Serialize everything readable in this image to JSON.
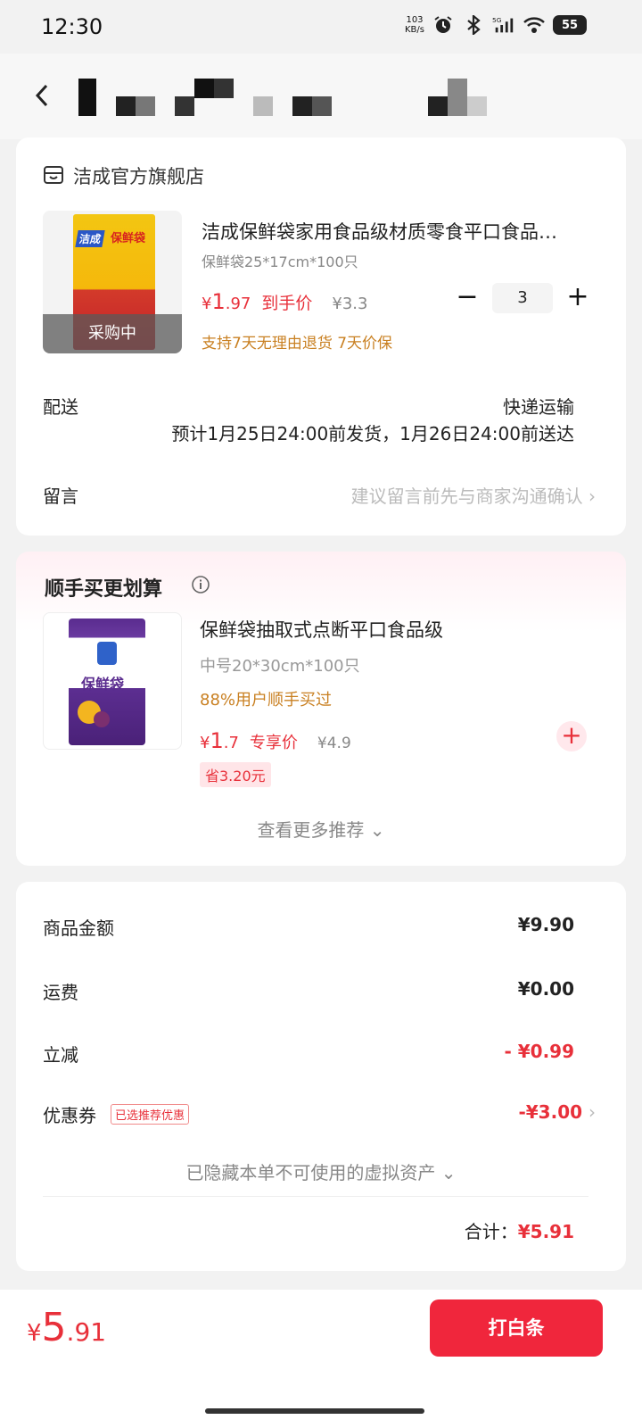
{
  "status_bar": {
    "time": "12:30",
    "speed_value": "103",
    "speed_unit": "KB/s",
    "battery": "55"
  },
  "header": {
    "title": ""
  },
  "order": {
    "store_name": "洁成官方旗舰店",
    "product": {
      "image_brand": "洁成",
      "image_name": "保鲜袋",
      "title": "洁成保鲜袋家用食品级材质零食平口食品…",
      "spec": "保鲜袋25*17cm*100只",
      "price_symbol": "¥",
      "price_int": "1",
      "price_dec": ".97",
      "price_tag": "到手价",
      "original_price": "¥3.3",
      "quantity": "3",
      "guarantee": "支持7天无理由退货 7天价保",
      "overlay": "采购中"
    },
    "delivery_label": "配送",
    "delivery_method": "快递运输",
    "delivery_estimate": "预计1月25日24:00前发货，1月26日24:00前送达",
    "message_label": "留言",
    "message_placeholder": "建议留言前先与商家沟通确认"
  },
  "recommend": {
    "title": "顺手买更划算",
    "item": {
      "image_name": "保鲜袋",
      "name": "保鲜袋抽取式点断平口食品级",
      "spec": "中号20*30cm*100只",
      "bought": "88%用户顺手买过",
      "price_symbol": "¥",
      "price_int": "1",
      "price_dec": ".7",
      "price_tag": "专享价",
      "original_price": "¥4.9",
      "save": "省3.20元"
    },
    "more": "查看更多推荐"
  },
  "summary": {
    "goods_label": "商品金额",
    "goods_value": "¥9.90",
    "shipping_label": "运费",
    "shipping_value": "¥0.00",
    "discount_label": "立减",
    "discount_value": "- ¥0.99",
    "coupon_label": "优惠券",
    "coupon_badge": "已选推荐优惠",
    "coupon_value": "-¥3.00",
    "hidden_assets": "已隐藏本单不可使用的虚拟资产",
    "total_label": "合计：",
    "total_value": "¥5.91"
  },
  "bottom": {
    "symbol": "¥",
    "pay_int": "5",
    "pay_dec": ".91",
    "pay_button": "打白条"
  },
  "colors": {
    "accent": "#e8303a",
    "orange": "#c98022",
    "button": "#f0263c",
    "background": "#f2f2f2"
  }
}
